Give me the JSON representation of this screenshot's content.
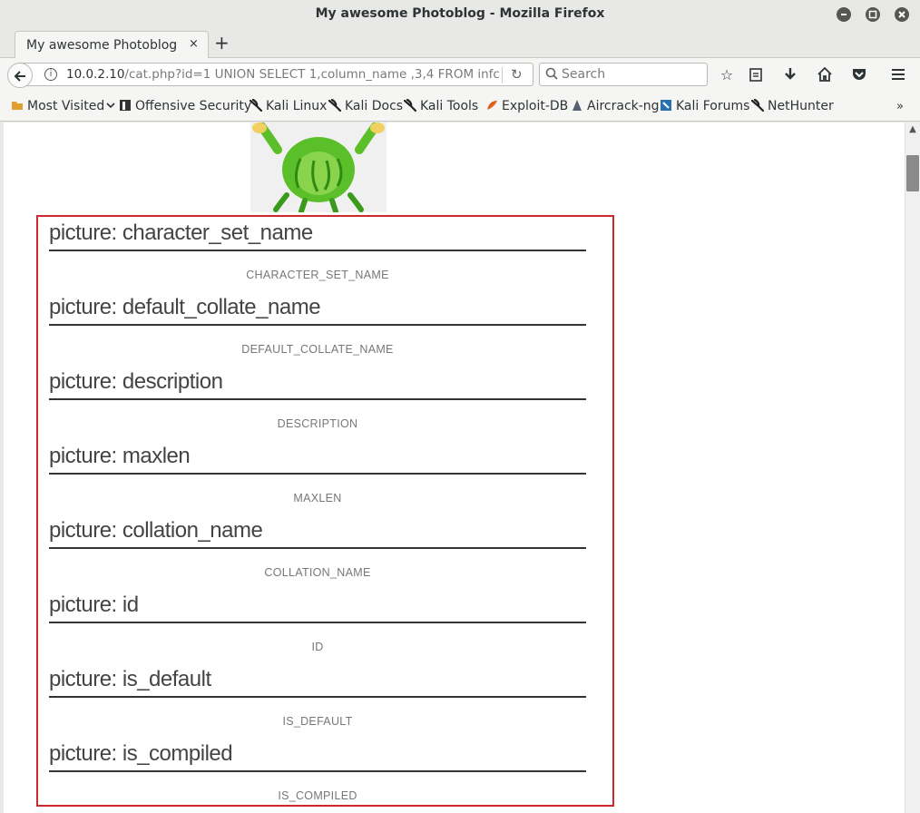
{
  "window": {
    "title": "My awesome Photoblog - Mozilla Firefox"
  },
  "tab": {
    "label": "My awesome Photoblog",
    "close": "×"
  },
  "newtab": "+",
  "nav": {
    "url_host": "10.0.2.10",
    "url_path": "/cat.php?id=1 UNION SELECT 1,column_name ,3,4 FROM infc",
    "search_placeholder": "Search"
  },
  "bookmarks": [
    {
      "label": "Most Visited",
      "icon": "folder-icon",
      "color": "#e0a030"
    },
    {
      "label": "Offensive Security",
      "icon": "offsec-icon",
      "color": "#333333"
    },
    {
      "label": "Kali Linux",
      "icon": "kali-dragon-icon",
      "color": "#222222"
    },
    {
      "label": "Kali Docs",
      "icon": "kali-dragon-icon",
      "color": "#222222"
    },
    {
      "label": "Kali Tools",
      "icon": "kali-dragon-icon",
      "color": "#222222"
    },
    {
      "label": "Exploit-DB",
      "icon": "exploitdb-icon",
      "color": "#e06020"
    },
    {
      "label": "Aircrack-ng",
      "icon": "aircrack-icon",
      "color": "#556070"
    },
    {
      "label": "Kali Forums",
      "icon": "kali-forums-icon",
      "color": "#2a6fb0"
    },
    {
      "label": "NetHunter",
      "icon": "kali-dragon-icon",
      "color": "#222222"
    }
  ],
  "entries": [
    {
      "title": "picture: character_set_name",
      "caption": "CHARACTER_SET_NAME"
    },
    {
      "title": "picture: default_collate_name",
      "caption": "DEFAULT_COLLATE_NAME"
    },
    {
      "title": "picture: description",
      "caption": "DESCRIPTION"
    },
    {
      "title": "picture: maxlen",
      "caption": "MAXLEN"
    },
    {
      "title": "picture: collation_name",
      "caption": "COLLATION_NAME"
    },
    {
      "title": "picture: id",
      "caption": "ID"
    },
    {
      "title": "picture: is_default",
      "caption": "IS_DEFAULT"
    },
    {
      "title": "picture: is_compiled",
      "caption": "IS_COMPILED"
    }
  ],
  "colors": {
    "highlight_frame": "#d0262d",
    "mascot_green": "#5bbf2a"
  }
}
